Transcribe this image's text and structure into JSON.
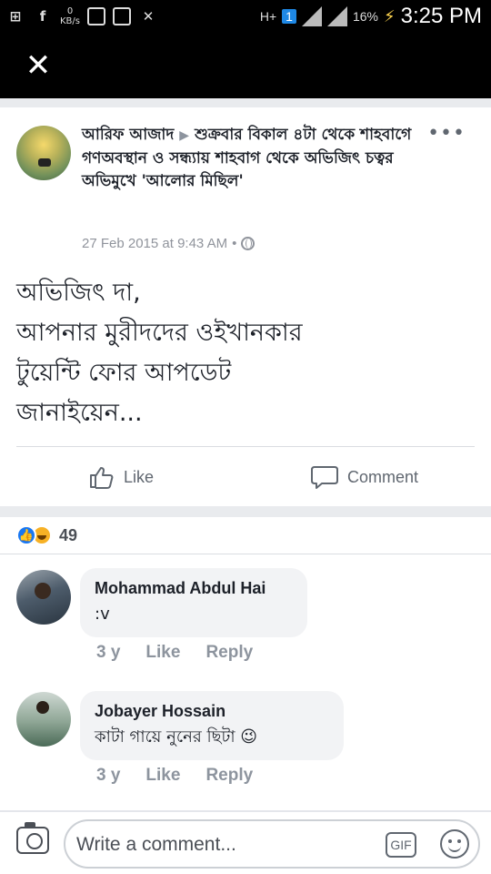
{
  "status_bar": {
    "network_speed_value": "0",
    "network_speed_unit": "KB/s",
    "network_type": "H+",
    "sim_badge": "1",
    "battery": "16%",
    "time": "3:25 PM"
  },
  "post": {
    "author": "আরিফ আজাদ",
    "event": "শুক্রবার বিকাল ৪টা থেকে শাহবাগে গণঅবস্থান ও সন্ধ্যায় শাহবাগ থেকে অভিজিৎ চত্বর অভিমুখে 'আলোর মিছিল'",
    "timestamp": "27 Feb 2015 at 9:43 AM",
    "privacy_sep": "•",
    "body_lines": [
      "অভিজিৎ দা,",
      "আপনার মুরীদদের ওইখানকার",
      "টুয়েন্টি ফোর আপডেট",
      "জানাইয়েন..."
    ]
  },
  "actions": {
    "like": "Like",
    "comment": "Comment"
  },
  "reactions": {
    "count": "49"
  },
  "comments": [
    {
      "name": "Mohammad Abdul Hai",
      "text": ":v",
      "age": "3 y",
      "like": "Like",
      "reply": "Reply"
    },
    {
      "name": "Jobayer Hossain",
      "text": "কাটা গায়ে নুনের ছিটা 😉",
      "age": "3 y",
      "like": "Like",
      "reply": "Reply"
    }
  ],
  "composer": {
    "placeholder": "Write a comment...",
    "gif_label": "GIF"
  },
  "colors": {
    "accent": "#1877f2",
    "top_bar": "#000000",
    "bubble": "#f2f3f5"
  }
}
